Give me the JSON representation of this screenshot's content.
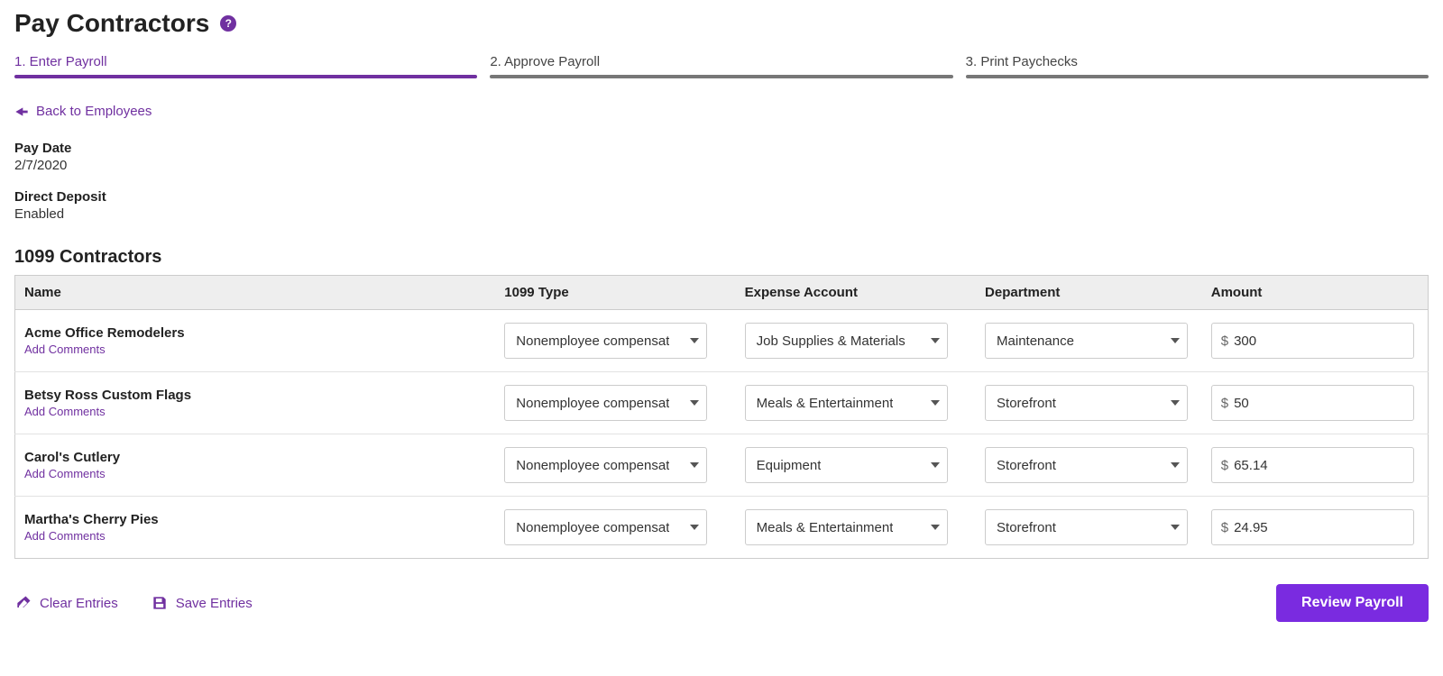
{
  "page": {
    "title": "Pay Contractors",
    "help_glyph": "?"
  },
  "stepper": {
    "steps": [
      {
        "label": "1. Enter Payroll",
        "active": true
      },
      {
        "label": "2. Approve Payroll",
        "active": false
      },
      {
        "label": "3. Print Paychecks",
        "active": false
      }
    ]
  },
  "back_link": "Back to Employees",
  "info": {
    "pay_date_label": "Pay Date",
    "pay_date_value": "2/7/2020",
    "dd_label": "Direct Deposit",
    "dd_value": "Enabled"
  },
  "section_title": "1099 Contractors",
  "table": {
    "headers": {
      "name": "Name",
      "type": "1099 Type",
      "expense": "Expense Account",
      "dept": "Department",
      "amount": "Amount"
    },
    "add_comments_label": "Add Comments",
    "currency_prefix": "$",
    "rows": [
      {
        "name": "Acme Office Remodelers",
        "type": "Nonemployee compensat",
        "expense": "Job Supplies & Materials",
        "dept": "Maintenance",
        "amount": "300"
      },
      {
        "name": "Betsy Ross Custom Flags",
        "type": "Nonemployee compensat",
        "expense": "Meals & Entertainment",
        "dept": "Storefront",
        "amount": "50"
      },
      {
        "name": "Carol's Cutlery",
        "type": "Nonemployee compensat",
        "expense": "Equipment",
        "dept": "Storefront",
        "amount": "65.14"
      },
      {
        "name": "Martha's Cherry Pies",
        "type": "Nonemployee compensat",
        "expense": "Meals & Entertainment",
        "dept": "Storefront",
        "amount": "24.95"
      }
    ]
  },
  "footer": {
    "clear": "Clear Entries",
    "save": "Save Entries",
    "review": "Review Payroll"
  }
}
